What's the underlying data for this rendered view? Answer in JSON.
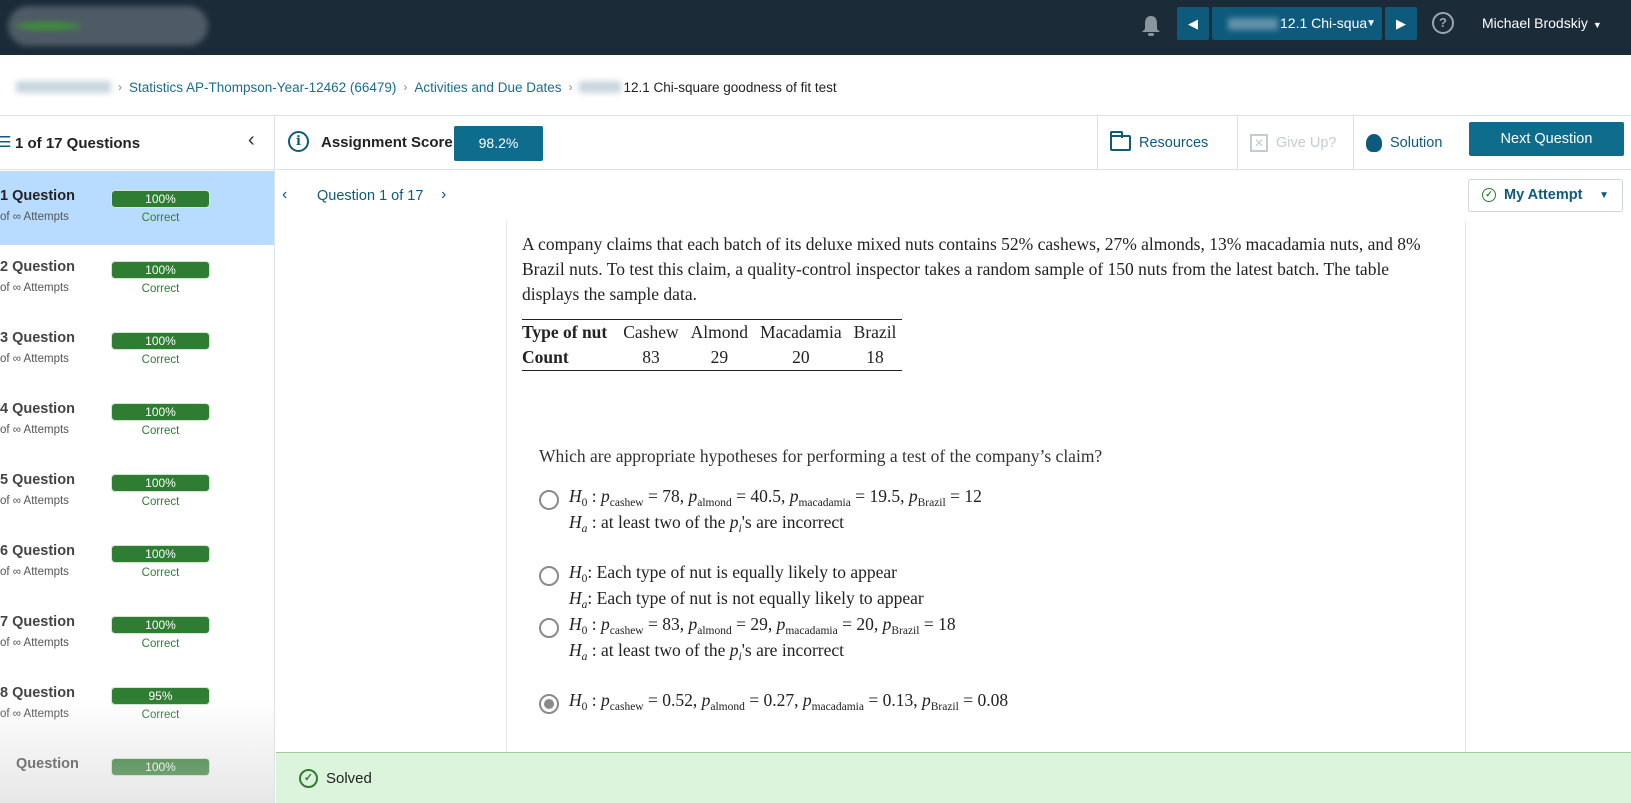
{
  "topbar": {
    "assignment_select": "12.1 Chi-squa",
    "user_name": "Michael Brodskiy"
  },
  "breadcrumb": {
    "course": "Statistics AP-Thompson-Year-12462 (66479)",
    "activities": "Activities and Due Dates",
    "current": "12.1 Chi-square goodness of fit test"
  },
  "sidebar": {
    "count_label": "1 of 17 Questions",
    "items": [
      {
        "name": "1 Question",
        "attempts": "of ∞ Attempts",
        "score": "100%",
        "status": "Correct"
      },
      {
        "name": "2 Question",
        "attempts": "of ∞ Attempts",
        "score": "100%",
        "status": "Correct"
      },
      {
        "name": "3 Question",
        "attempts": "of ∞ Attempts",
        "score": "100%",
        "status": "Correct"
      },
      {
        "name": "4 Question",
        "attempts": "of ∞ Attempts",
        "score": "100%",
        "status": "Correct"
      },
      {
        "name": "5 Question",
        "attempts": "of ∞ Attempts",
        "score": "100%",
        "status": "Correct"
      },
      {
        "name": "6 Question",
        "attempts": "of ∞ Attempts",
        "score": "100%",
        "status": "Correct"
      },
      {
        "name": "7 Question",
        "attempts": "of ∞ Attempts",
        "score": "100%",
        "status": "Correct"
      },
      {
        "name": "8 Question",
        "attempts": "of ∞ Attempts",
        "score": "95%",
        "status": "Correct"
      },
      {
        "name": "Question",
        "attempts": "",
        "score": "100%",
        "status": ""
      }
    ]
  },
  "assignment": {
    "score_label": "Assignment Score:",
    "score_value": "98.2%",
    "resources": "Resources",
    "give_up": "Give Up?",
    "solution": "Solution",
    "next_question": "Next Question"
  },
  "question_nav": {
    "label": "Question 1 of 17",
    "my_attempt": "My Attempt"
  },
  "question": {
    "stem": "A company claims that each batch of its deluxe mixed nuts contains 52% cashews, 27% almonds, 13% macadamia nuts, and 8% Brazil nuts. To test this claim, a quality-control inspector takes a random sample of 150 nuts from the latest batch. The table displays the sample data.",
    "table": {
      "row_header": "Type of nut",
      "count_header": "Count",
      "columns": [
        "Cashew",
        "Almond",
        "Macadamia",
        "Brazil"
      ],
      "counts": [
        "83",
        "29",
        "20",
        "18"
      ]
    },
    "prompt": "Which are appropriate hypotheses for performing a test of the company’s claim?",
    "options": [
      {
        "h0_vals": [
          "78",
          "40.5",
          "19.5",
          "12"
        ],
        "ha_text": " : at least two of the ",
        "ha_tail": "'s are incorrect",
        "selected": false
      },
      {
        "h0_text": ": Each type of nut is equally likely to appear",
        "ha_text": ": Each type of nut is not equally likely to appear",
        "selected": false
      },
      {
        "h0_vals": [
          "83",
          "29",
          "20",
          "18"
        ],
        "ha_text": " : at least two of the ",
        "ha_tail": "'s are incorrect",
        "selected": false
      },
      {
        "h0_vals": [
          "0.52",
          "0.27",
          "0.13",
          "0.08"
        ],
        "selected": true
      }
    ],
    "sub_labels": {
      "cashew": "cashew",
      "almond": "almond",
      "macadamia": "macadamia",
      "brazil": "Brazil"
    }
  },
  "status_bar": {
    "text": "Solved"
  }
}
